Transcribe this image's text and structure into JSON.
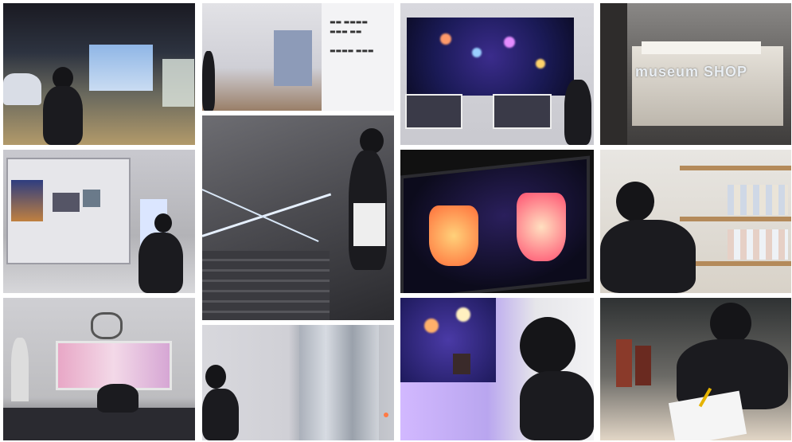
{
  "collage": {
    "background": "#ffffff",
    "tiles": [
      {
        "id": "t1",
        "subject": "museum gallery corridor with vintage car and visitor"
      },
      {
        "id": "t2",
        "subject": "hallway with wall sign"
      },
      {
        "id": "t3",
        "subject": "large screen with lanterns and touch kiosks"
      },
      {
        "id": "t4",
        "subject": "museum shop entrance"
      },
      {
        "id": "t5",
        "subject": "display case exhibit with visitor"
      },
      {
        "id": "t6",
        "subject": "glass staircase with visitor"
      },
      {
        "id": "t7",
        "subject": "touch screen with glowing lanterns"
      },
      {
        "id": "t8",
        "subject": "visitor browsing shop shelves"
      },
      {
        "id": "t9",
        "subject": "stage with emblem and screen"
      },
      {
        "id": "t10",
        "subject": "visitor near elevator doors"
      },
      {
        "id": "t11",
        "subject": "visitor photographing lantern screen"
      },
      {
        "id": "t12",
        "subject": "visitor writing at table"
      }
    ]
  },
  "signs": {
    "shop": "museum SHOP"
  }
}
